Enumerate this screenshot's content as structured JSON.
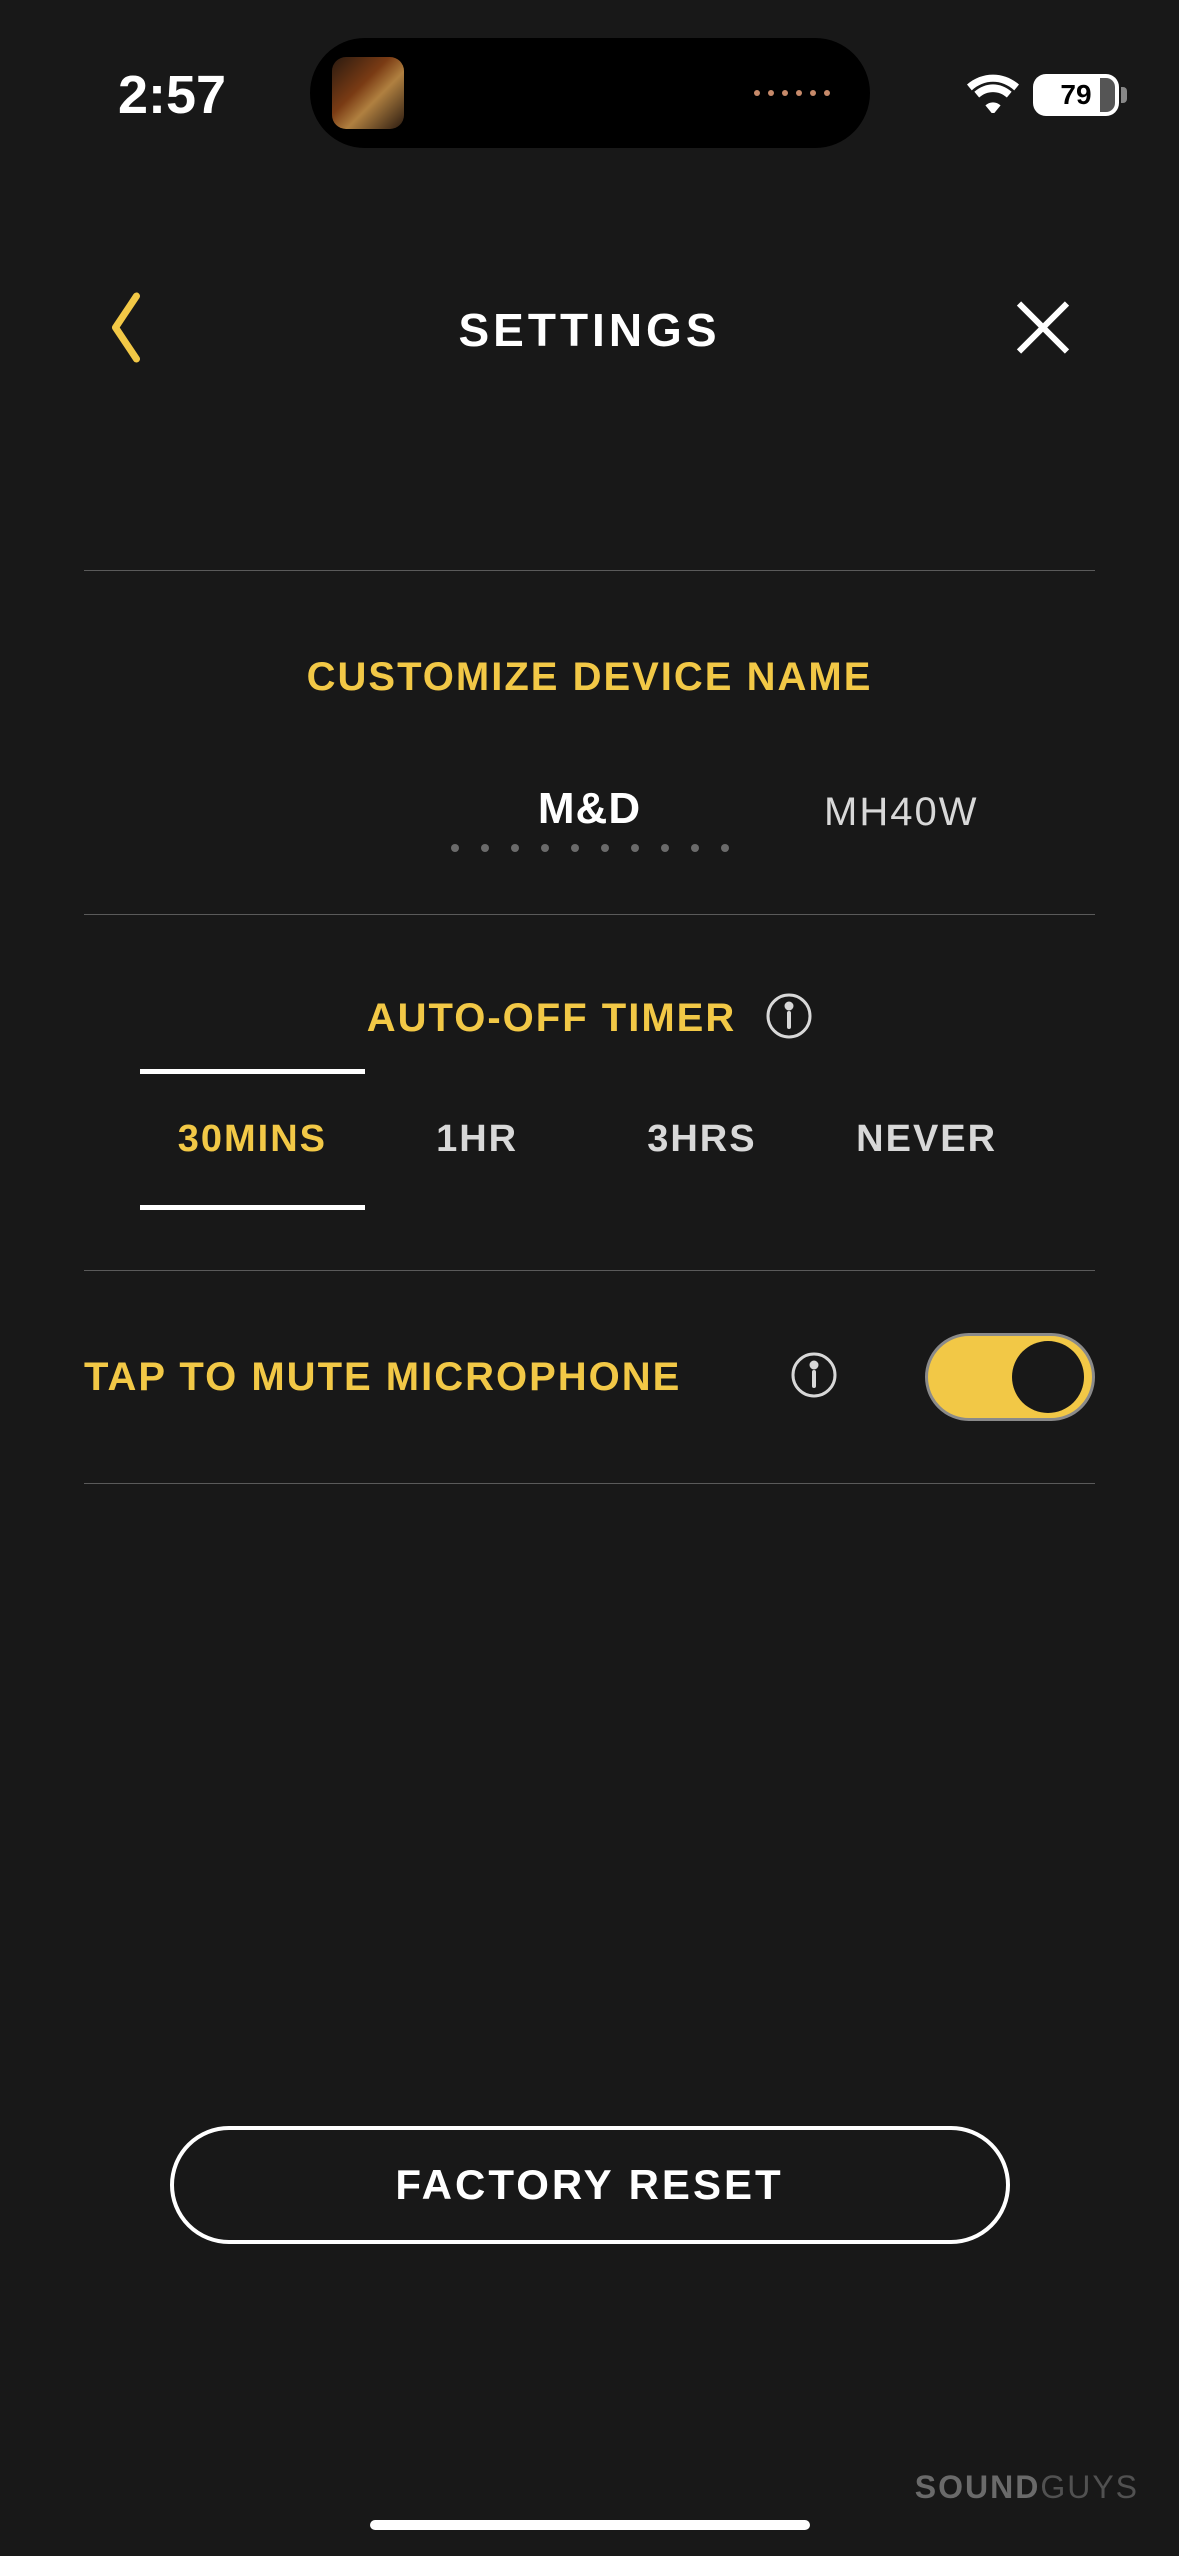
{
  "status": {
    "time": "2:57",
    "battery": "79"
  },
  "header": {
    "title": "SETTINGS"
  },
  "device_name": {
    "section_title": "CUSTOMIZE DEVICE NAME",
    "value": "M&D",
    "suffix": "MH40W"
  },
  "auto_off": {
    "section_title": "AUTO-OFF TIMER",
    "options": [
      "30MINS",
      "1HR",
      "3HRS",
      "NEVER"
    ],
    "selected_index": 0
  },
  "mute": {
    "label": "TAP TO MUTE MICROPHONE",
    "enabled": true
  },
  "factory_reset_label": "FACTORY RESET",
  "watermark": {
    "bold": "SOUND",
    "light": "GUYS"
  }
}
